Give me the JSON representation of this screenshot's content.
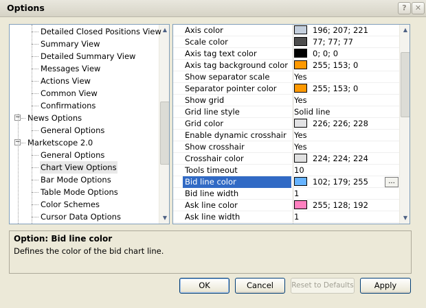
{
  "window": {
    "title": "Options",
    "help_label": "?",
    "close_label": "✕"
  },
  "tree": {
    "items": [
      {
        "label": "Detailed Closed Positions View",
        "level": 2
      },
      {
        "label": "Summary View",
        "level": 2
      },
      {
        "label": "Detailed Summary View",
        "level": 2
      },
      {
        "label": "Messages View",
        "level": 2
      },
      {
        "label": "Actions View",
        "level": 2
      },
      {
        "label": "Common View",
        "level": 2
      },
      {
        "label": "Confirmations",
        "level": 2
      },
      {
        "label": "News Options",
        "level": 1,
        "toggle": "−"
      },
      {
        "label": "General Options",
        "level": 2
      },
      {
        "label": "Marketscope 2.0",
        "level": 1,
        "toggle": "−"
      },
      {
        "label": "General Options",
        "level": 2
      },
      {
        "label": "Chart View Options",
        "level": 2,
        "selected": true
      },
      {
        "label": "Bar Mode Options",
        "level": 2
      },
      {
        "label": "Table Mode Options",
        "level": 2
      },
      {
        "label": "Color Schemes",
        "level": 2
      },
      {
        "label": "Cursor Data Options",
        "level": 2
      }
    ]
  },
  "properties": [
    {
      "name": "Axis color",
      "value": "196; 207; 221",
      "color": "#c4cfdd"
    },
    {
      "name": "Scale color",
      "value": "77; 77; 77",
      "color": "#4d4d4d"
    },
    {
      "name": "Axis tag text color",
      "value": "0; 0; 0",
      "color": "#000000"
    },
    {
      "name": "Axis tag background color",
      "value": "255; 153; 0",
      "color": "#ff9900"
    },
    {
      "name": "Show separator scale",
      "value": "Yes"
    },
    {
      "name": "Separator pointer color",
      "value": "255; 153; 0",
      "color": "#ff9900"
    },
    {
      "name": "Show grid",
      "value": "Yes"
    },
    {
      "name": "Grid line style",
      "value": "Solid line"
    },
    {
      "name": "Grid color",
      "value": "226; 226; 228",
      "color": "#e2e2e4"
    },
    {
      "name": "Enable dynamic crosshair",
      "value": "Yes"
    },
    {
      "name": "Show crosshair",
      "value": "Yes"
    },
    {
      "name": "Crosshair color",
      "value": "224; 224; 224",
      "color": "#e0e0e0"
    },
    {
      "name": "Tools timeout",
      "value": "10"
    },
    {
      "name": "Bid line color",
      "value": "102; 179; 255",
      "color": "#66b3ff",
      "selected": true,
      "ellipsis": "..."
    },
    {
      "name": "Bid line width",
      "value": "1"
    },
    {
      "name": "Ask line color",
      "value": "255; 128; 192",
      "color": "#ff80c0"
    },
    {
      "name": "Ask line width",
      "value": "1"
    }
  ],
  "description": {
    "title": "Option: Bid line color",
    "text": "Defines the color of the bid chart line."
  },
  "buttons": {
    "ok": "OK",
    "cancel": "Cancel",
    "reset": "Reset to Defaults",
    "apply": "Apply"
  },
  "colors": {
    "selection": "#316ac5",
    "border": "#7f9db9"
  }
}
